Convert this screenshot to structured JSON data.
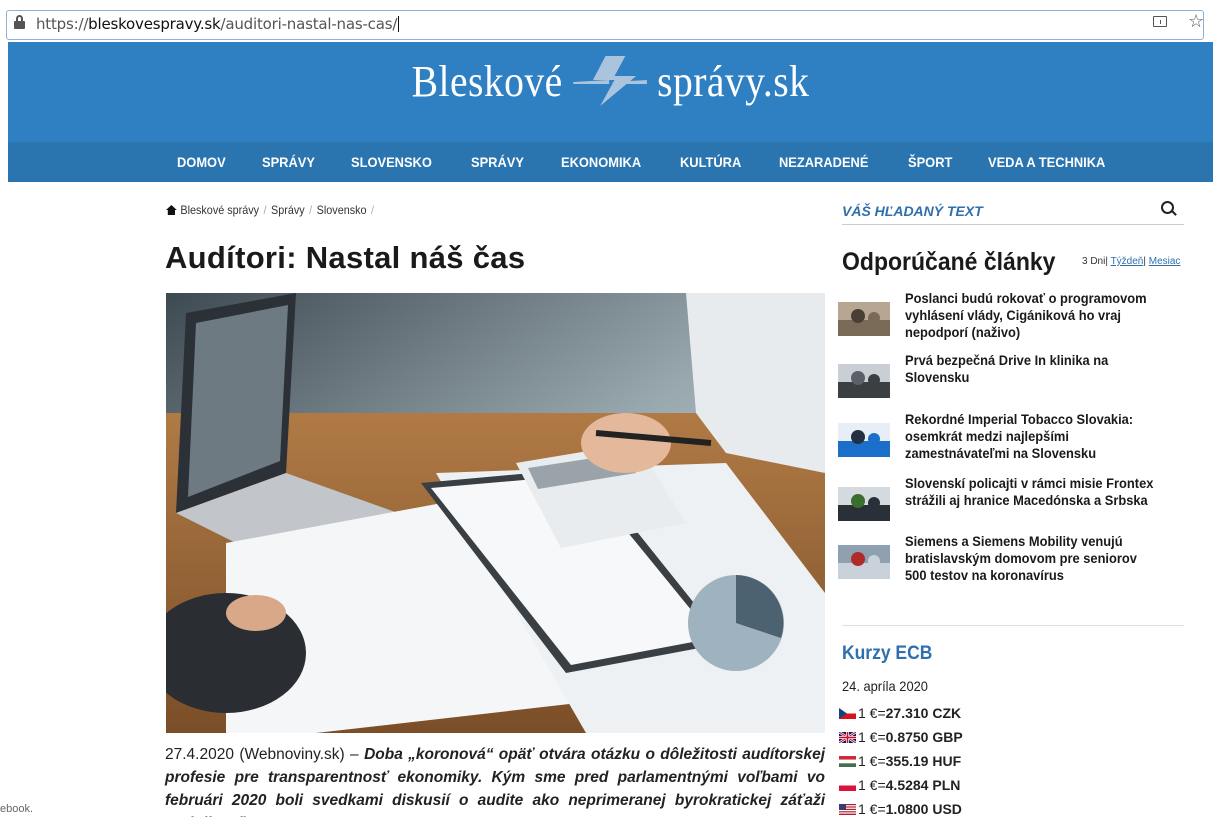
{
  "browser": {
    "url_prefix": "https://",
    "url_domain": "bleskovespravy.sk",
    "url_path": "/auditori-nastal-nas-cas/"
  },
  "site": {
    "logo_left": "Bleskové",
    "logo_right": "správy.sk",
    "brand_color": "#2f80c3"
  },
  "nav": {
    "items": [
      "DOMOV",
      "SPRÁVY",
      "SLOVENSKO",
      "SPRÁVY",
      "EKONOMIKA",
      "KULTÚRA",
      "NEZARADENÉ",
      "ŠPORT",
      "VEDA A TECHNIKA"
    ]
  },
  "breadcrumb": {
    "items": [
      "Bleskové správy",
      "Správy",
      "Slovensko"
    ]
  },
  "article": {
    "title": "Audítori: Nastal náš čas",
    "hero_alt": "accounting-desk-image",
    "date_source": "27.4.2020 (Webnoviny.sk) –",
    "lede": "Doba „koronová“ opäť otvára otázku o dôležitosti audítorskej profesie pre transparentnosť ekonomiky. Kým sme pred parlamentnými voľbami vo februári 2020 boli svedkami diskusií o audite ako neprimeranej byrokratickej záťaži podnikateľov,"
  },
  "left_edge_text": "ebook.",
  "sidebar": {
    "search_placeholder": "VÁŠ HĽADANÝ TEXT",
    "recommended_title": "Odporúčané články",
    "tabs": {
      "days": "3 Dni",
      "week": "Týždeň",
      "month": "Mesiac"
    },
    "articles": [
      {
        "title": "Poslanci budú rokovať o programovom vyhlásení vlády, Cigániková ho vraj nepodporí (naživo)",
        "thumb": "parliament-thumb"
      },
      {
        "title": "Prvá bezpečná Drive In klinika na Slovensku",
        "thumb": "car-thumb"
      },
      {
        "title": "Rekordné Imperial Tobacco Slovakia: osemkrát medzi najlepšími zamestnávateľmi na Slovensku",
        "thumb": "person-thumb"
      },
      {
        "title": "Slovenskí policajti v rámci misie Frontex strážili aj hranice Macedónska a Srbska",
        "thumb": "police-thumb"
      },
      {
        "title": "Siemens a Siemens Mobility venujú bratislavským domovom pre seniorov 500 testov na koronavírus",
        "thumb": "tests-thumb"
      }
    ],
    "ecb": {
      "title": "Kurzy ECB",
      "date": "24. apríla 2020",
      "rates": [
        {
          "flag": "cz-flag",
          "prefix": "1 €=",
          "value": "27.310 CZK"
        },
        {
          "flag": "gb-flag",
          "prefix": "1 €=",
          "value": "0.8750 GBP"
        },
        {
          "flag": "hu-flag",
          "prefix": "1 €=",
          "value": "355.19 HUF"
        },
        {
          "flag": "pl-flag",
          "prefix": "1 €=",
          "value": "4.5284 PLN"
        },
        {
          "flag": "us-flag",
          "prefix": "1 €=",
          "value": "1.0800 USD"
        }
      ]
    }
  }
}
